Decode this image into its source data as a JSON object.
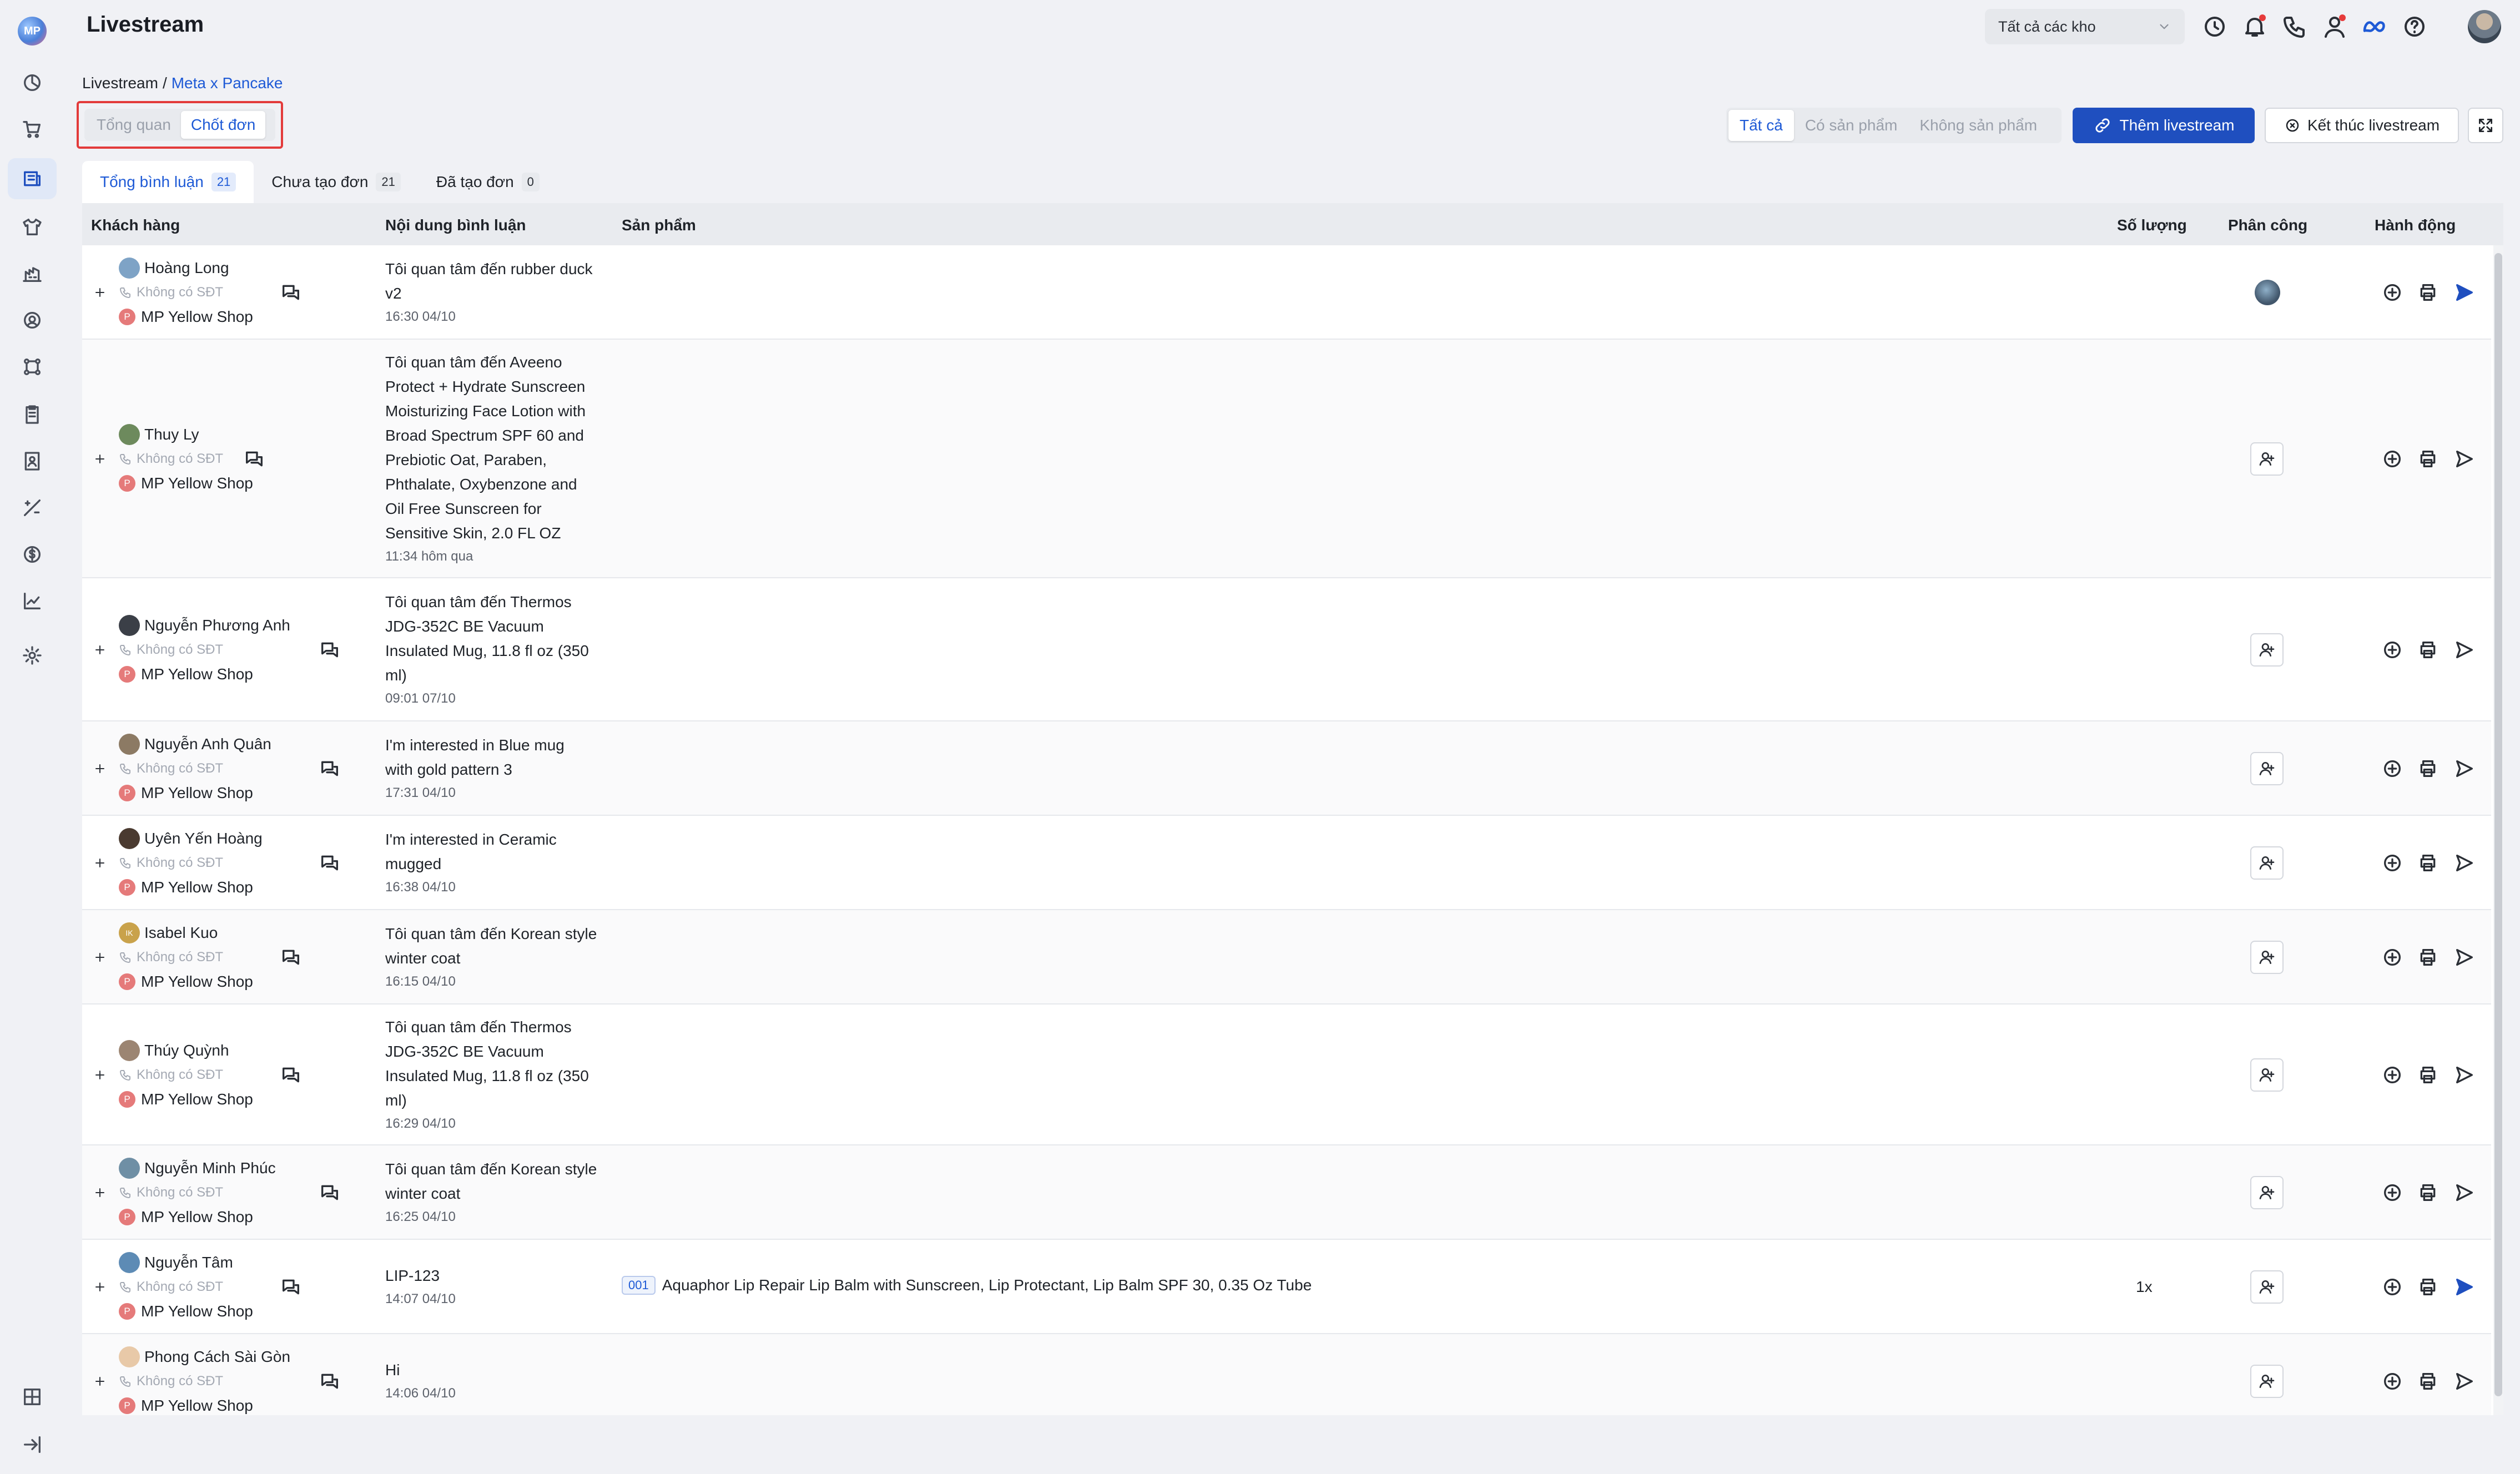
{
  "app_title": "Livestream",
  "header": {
    "warehouse_select": "Tất cả các kho",
    "icons": [
      "clock-icon",
      "bell-icon",
      "phone-icon",
      "user-icon",
      "meta-icon",
      "help-icon"
    ]
  },
  "sidebar": {
    "logo": "MP",
    "items": [
      "dashboard",
      "orders",
      "livestream",
      "products",
      "warehouse",
      "customers",
      "integrations",
      "reports-list",
      "contacts",
      "promotions",
      "finance",
      "analytics",
      "settings",
      "apps",
      "collapse"
    ],
    "active": "livestream"
  },
  "breadcrumb": {
    "root": "Livestream",
    "sep": "/",
    "current": "Meta x Pancake"
  },
  "view_toggle": {
    "overview": "Tổng quan",
    "close_orders": "Chốt đơn"
  },
  "filter": {
    "all": "Tất cả",
    "with_product": "Có sản phẩm",
    "without_product": "Không sản phẩm"
  },
  "buttons": {
    "add_livestream": "Thêm livestream",
    "end_livestream": "Kết thúc livestream"
  },
  "tabs": [
    {
      "label": "Tổng bình luận",
      "count": "21"
    },
    {
      "label": "Chưa tạo đơn",
      "count": "21"
    },
    {
      "label": "Đã tạo đơn",
      "count": "0"
    }
  ],
  "columns": {
    "customer": "Khách hàng",
    "comment": "Nội dung bình luận",
    "product": "Sản phẩm",
    "quantity": "Số lượng",
    "assign": "Phân công",
    "action": "Hành động"
  },
  "colors": {
    "primary": "#1f4fbf",
    "link": "#1e5ad6",
    "highlight_border": "#e33b3b"
  },
  "rows": [
    {
      "name": "Hoàng Long",
      "phone": "Không có SĐT",
      "shop": "MP Yellow Shop",
      "shop_initial": "P",
      "comment": [
        "Tôi quan tâm đến rubber duck",
        "v2"
      ],
      "time": "16:30 04/10",
      "product_code": "",
      "product": "",
      "qty": "",
      "assigned": true,
      "sent": true
    },
    {
      "name": "Thuy Ly",
      "phone": "Không có SĐT",
      "shop": "MP Yellow Shop",
      "shop_initial": "P",
      "comment": [
        "Tôi quan tâm đến Aveeno",
        "Protect + Hydrate Sunscreen",
        "Moisturizing Face Lotion with",
        "Broad Spectrum SPF 60 and",
        "Prebiotic Oat, Paraben,",
        "Phthalate, Oxybenzone and",
        "Oil Free Sunscreen for",
        "Sensitive Skin, 2.0 FL OZ"
      ],
      "time": "11:34 hôm qua",
      "product_code": "",
      "product": "",
      "qty": "",
      "assigned": false,
      "sent": false
    },
    {
      "name": "Nguyễn Phương Anh",
      "phone": "Không có SĐT",
      "shop": "MP Yellow Shop",
      "shop_initial": "P",
      "comment": [
        "Tôi quan tâm đến Thermos",
        "JDG-352C BE Vacuum",
        "Insulated Mug, 11.8 fl oz (350",
        "ml)"
      ],
      "time": "09:01 07/10",
      "product_code": "",
      "product": "",
      "qty": "",
      "assigned": false,
      "sent": false
    },
    {
      "name": "Nguyễn Anh Quân",
      "phone": "Không có SĐT",
      "shop": "MP Yellow Shop",
      "shop_initial": "P",
      "comment": [
        "I'm interested in Blue mug",
        "with gold pattern 3"
      ],
      "time": "17:31 04/10",
      "product_code": "",
      "product": "",
      "qty": "",
      "assigned": false,
      "sent": false
    },
    {
      "name": "Uyên Yến Hoàng",
      "phone": "Không có SĐT",
      "shop": "MP Yellow Shop",
      "shop_initial": "P",
      "comment": [
        "I'm interested in Ceramic",
        "mugged"
      ],
      "time": "16:38 04/10",
      "product_code": "",
      "product": "",
      "qty": "",
      "assigned": false,
      "sent": false
    },
    {
      "name": "Isabel Kuo",
      "phone": "Không có SĐT",
      "shop": "MP Yellow Shop",
      "shop_initial": "P",
      "avatar_initials": "IK",
      "comment": [
        "Tôi quan tâm đến Korean style",
        "winter coat"
      ],
      "time": "16:15 04/10",
      "product_code": "",
      "product": "",
      "qty": "",
      "assigned": false,
      "sent": false
    },
    {
      "name": "Thúy Quỳnh",
      "phone": "Không có SĐT",
      "shop": "MP Yellow Shop",
      "shop_initial": "P",
      "comment": [
        "Tôi quan tâm đến Thermos",
        "JDG-352C BE Vacuum",
        "Insulated Mug, 11.8 fl oz (350",
        "ml)"
      ],
      "time": "16:29 04/10",
      "product_code": "",
      "product": "",
      "qty": "",
      "assigned": false,
      "sent": false
    },
    {
      "name": "Nguyễn Minh Phúc",
      "phone": "Không có SĐT",
      "shop": "MP Yellow Shop",
      "shop_initial": "P",
      "comment": [
        "Tôi quan tâm đến Korean style",
        "winter coat"
      ],
      "time": "16:25 04/10",
      "product_code": "",
      "product": "",
      "qty": "",
      "assigned": false,
      "sent": false
    },
    {
      "name": "Nguyễn Tâm",
      "phone": "Không có SĐT",
      "shop": "MP Yellow Shop",
      "shop_initial": "P",
      "comment": [
        "LIP-123"
      ],
      "time": "14:07 04/10",
      "product_code": "001",
      "product": "Aquaphor Lip Repair Lip Balm with Sunscreen, Lip Protectant, Lip Balm SPF 30, 0.35 Oz Tube",
      "qty": "1x",
      "assigned": false,
      "sent": true
    },
    {
      "name": "Phong Cách Sài Gòn",
      "phone": "Không có SĐT",
      "shop": "MP Yellow Shop",
      "shop_initial": "P",
      "comment": [
        "Hi"
      ],
      "time": "14:06 04/10",
      "product_code": "",
      "product": "",
      "qty": "",
      "assigned": false,
      "sent": false
    }
  ]
}
